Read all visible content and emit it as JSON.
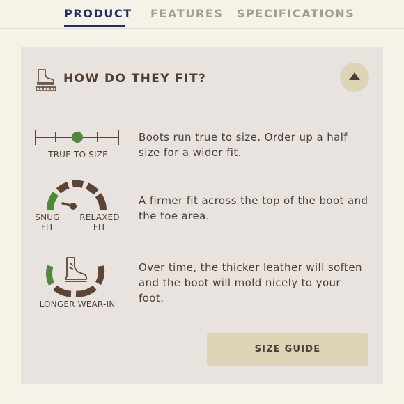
{
  "tabs": [
    {
      "label": "PRODUCT",
      "active": true
    },
    {
      "label": "FEATURES",
      "active": false
    },
    {
      "label": "SPECIFICATIONS",
      "active": false
    }
  ],
  "panel": {
    "title": "HOW DO THEY FIT?",
    "collapse_icon": "triangle-up-icon",
    "rows": [
      {
        "icon": "true-to-size-scale-icon",
        "caption": "TRUE TO SIZE",
        "text": "Boots run true to size. Order up a half size for a wider fit."
      },
      {
        "icon": "fit-gauge-icon",
        "caption_left_1": "SNUG",
        "caption_left_2": "FIT",
        "caption_right_1": "RELAXED",
        "caption_right_2": "FIT",
        "text": "A firmer fit across the top of the boot and the toe area."
      },
      {
        "icon": "wear-in-boot-icon",
        "caption": "LONGER WEAR-IN",
        "text": "Over time, the thicker leather will soften and the boot will mold nicely to your foot."
      }
    ],
    "size_guide_label": "SIZE GUIDE"
  },
  "colors": {
    "accent_blue": "#1f2f66",
    "brown": "#5c4535",
    "green": "#4f8a3b",
    "panel_bg": "#e8e3df",
    "button_bg": "#ddd3b5"
  }
}
